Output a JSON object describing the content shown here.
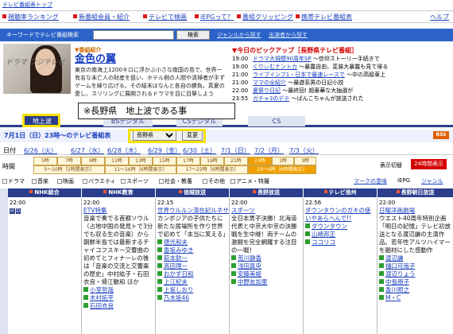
{
  "top": {
    "title": "テレビ番組表トップ"
  },
  "nav": {
    "items": [
      "視聴率ランキング",
      "新番組会員・紹介",
      "テレビで検画",
      "iEPGって？",
      "番組クリッピング",
      "携帯テレビ番組表"
    ],
    "help": "ヘルプ"
  },
  "search": {
    "label": "キーワードでテレビ番組検索",
    "value": "",
    "button": "検索",
    "link1": "ジャンルから探す",
    "link2": "出演者から探す"
  },
  "promo": {
    "image_text": "ドラマ フジテレビ",
    "heading": "▼番組紹介",
    "title": "金色の翼",
    "desc": "東京の南海上1200キロに浮かぶ小さな南国の島で、世界一有名な未亡人の財産を狙い、ホテル側の人間や清掃者が手ずゲームを繰り広げる。その結末はなんと各自の勝負。真夏の愛し、スリリングに展開されるドラマを目に目撃しよう"
  },
  "pickup": {
    "heading": "▼今日のピックアップ［長野県テレビ番組］",
    "rows": [
      {
        "time": "19:00",
        "title": "ドラマ大規模90周年SP",
        "note": "～信仰ストーリー手続きで"
      },
      {
        "time": "19:00",
        "title": "くりぃむナントカ",
        "note": "～暴露自由、変装大暴露も見て帰る"
      },
      {
        "time": "21:00",
        "title": "ライブインフ1・日本で最速レースで",
        "note": "～中の高級車上"
      },
      {
        "time": "21:00",
        "title": "ママの全紹介",
        "note": "～最遊系男の日記小説"
      },
      {
        "time": "22:00",
        "title": "夏祭り日記",
        "note": "～最終回! 超豪華な大抽選が"
      },
      {
        "time": "23:55",
        "title": "ガチャ3のデテ",
        "note": "～ばんこちゃんが放送された"
      }
    ]
  },
  "annotation": "※長野県　地上波である事",
  "tabs": [
    "地上波",
    "BSデジタル",
    "CSデジタル",
    "CS"
  ],
  "daterow": {
    "label": "7月1日（日）23時～のテレビ番組表",
    "region": "長野県",
    "change": "変更",
    "rss": "RSS"
  },
  "days": {
    "label": "日付",
    "items": [
      "6/26（火）",
      "6/27（水）",
      "6/28（木）",
      "6/29（金）",
      "6/30（土）",
      "7/1（日）",
      "7/2（月）",
      "7/3（火）"
    ]
  },
  "time": {
    "label": "時間",
    "hours": [
      "5時",
      "7時",
      "9時",
      "11時",
      "13時",
      "15時",
      "17時",
      "19時",
      "21時",
      "23時",
      "1時",
      "3時"
    ],
    "ranges": [
      "5～10時［5時間表示］",
      "11～16時［6時間表示］",
      "17～22時［6時間表示］",
      "23～4時［6時間表示］"
    ],
    "display_switch": "表示切替",
    "display_btn": "24時間表示"
  },
  "genres": [
    "ドラマ",
    "音楽",
    "映画",
    "バラエティ",
    "スポーツ",
    "社会・教養",
    "その他",
    "アニメ・特撮",
    "マークの意味",
    "iEPG",
    "ジャンル"
  ],
  "channels": [
    "NHK総合",
    "NHK教育",
    "信越放送",
    "長野放送",
    "テレビ信州",
    "長野朝日放送"
  ],
  "programs": {
    "c1_time": "22:00",
    "c2_time": "22:00",
    "c2_title": "ETV特集",
    "c2_desc": "音楽で奏でる首都ソウル（占地中国の発見トで3分でも収る生の音楽）から朝鮮半島では最新するチャイコフスキー交響曲の初めてとフィナーレの後は「音楽の交流と交響楽の歴史」中村紘子・石田衣良・帰江敏和 ほか",
    "c2_links": [
      "小室哲哉",
      "木村拓平",
      "石田衣良"
    ],
    "c3_time": "22:15",
    "c3_title": "世界ウルルン滞在記ルネサンス",
    "c3_desc": "カンボジアの子供たちに新たな居場所を作り世界で初めて「本当に笑える」",
    "c3_links": [
      "徳光和夫",
      "香坂みゆき",
      "萩本欽一",
      "高田理一",
      "おかず日和",
      "上江紀夫",
      "上坂しおり",
      "乃木坂46"
    ],
    "c4_time": "22:00",
    "c4_title": "スポーツ",
    "c4_desc": "全日本男子決勝！北海道代表と中京大中京の決勝戦を生中継！両チームの激闘を完全網羅する注目の一戦！",
    "c4_links": [
      "荒川静香",
      "浅田真央",
      "安藤美姫",
      "中野友加里"
    ],
    "c5_time": "22:56",
    "c5_title": "ダウンタウンのガキの使いやあらへんで!!",
    "c5_links": [
      "ダウンタウン",
      "山崎邦正",
      "ココリコ"
    ],
    "c6_time": "22:00",
    "c6_title": "日曜洋画劇場",
    "c6_desc": "ウエスト40周年特別企画「明日の記憶」テレビ初放送となる渡辺謙の主演作品。若年性アルツハイマーを題材にした感動作",
    "c6_links": [
      "渡辺謙",
      "樋口可南子",
      "渡辺りょう",
      "中島朋子",
      "香川照之",
      "M・C"
    ]
  }
}
